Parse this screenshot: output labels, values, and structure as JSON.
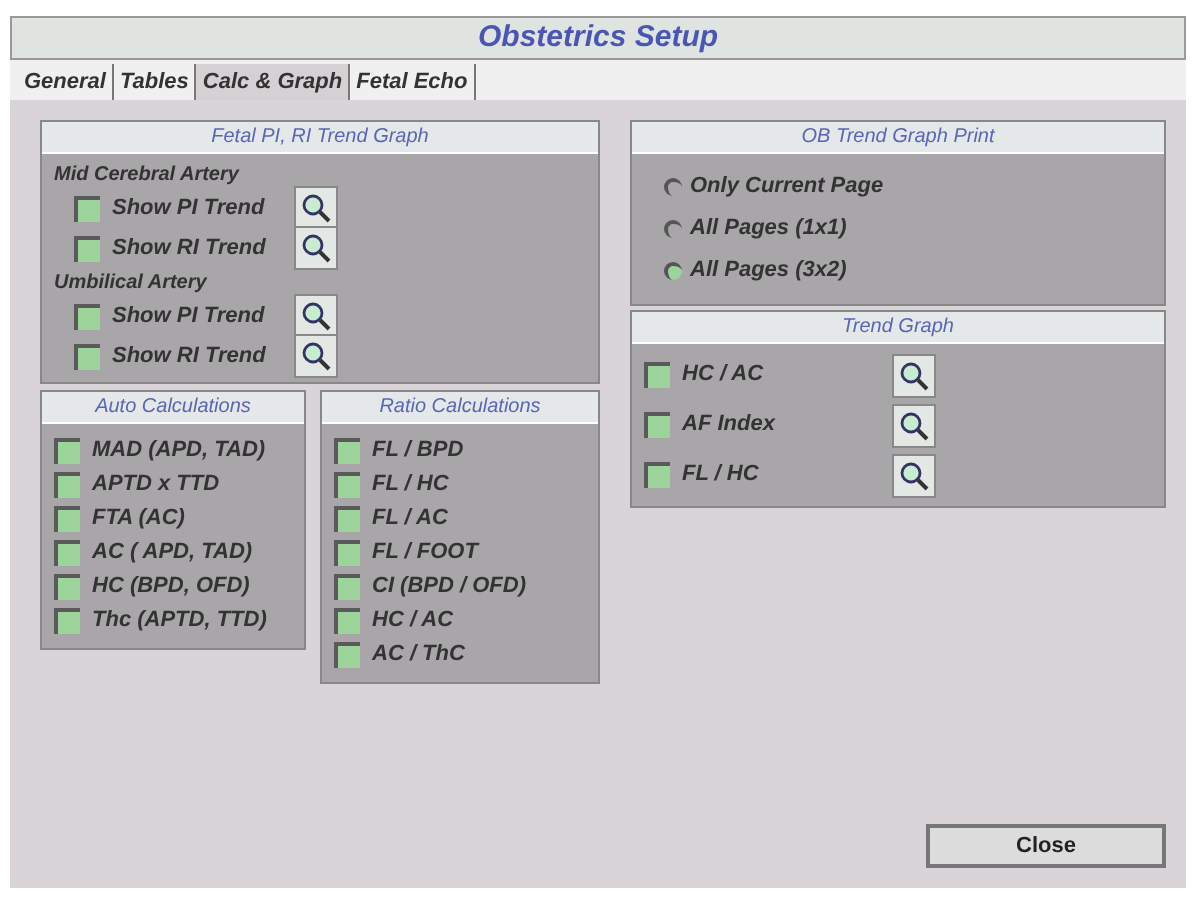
{
  "window": {
    "title": "Obstetrics Setup"
  },
  "tabs": [
    {
      "label": "General",
      "selected": false
    },
    {
      "label": "Tables",
      "selected": false
    },
    {
      "label": "Calc & Graph",
      "selected": true
    },
    {
      "label": "Fetal Echo",
      "selected": false
    }
  ],
  "fetal_trend": {
    "title": "Fetal PI, RI Trend Graph",
    "groups": [
      {
        "label": "Mid Cerebral Artery",
        "items": [
          {
            "label": "Show PI Trend",
            "checked": false
          },
          {
            "label": "Show RI Trend",
            "checked": false
          }
        ]
      },
      {
        "label": "Umbilical Artery",
        "items": [
          {
            "label": "Show PI Trend",
            "checked": false
          },
          {
            "label": "Show RI Trend",
            "checked": false
          }
        ]
      }
    ]
  },
  "auto_calculations": {
    "title": "Auto Calculations",
    "items": [
      {
        "label": "MAD (APD, TAD)",
        "checked": false
      },
      {
        "label": "APTD x TTD",
        "checked": false
      },
      {
        "label": "FTA (AC)",
        "checked": false
      },
      {
        "label": "AC ( APD, TAD)",
        "checked": false
      },
      {
        "label": "HC (BPD, OFD)",
        "checked": false
      },
      {
        "label": "Thc (APTD, TTD)",
        "checked": false
      }
    ]
  },
  "ratio_calculations": {
    "title": "Ratio Calculations",
    "items": [
      {
        "label": "FL / BPD",
        "checked": false
      },
      {
        "label": "FL / HC",
        "checked": false
      },
      {
        "label": "FL / AC",
        "checked": false
      },
      {
        "label": "FL / FOOT",
        "checked": false
      },
      {
        "label": "CI (BPD / OFD)",
        "checked": false
      },
      {
        "label": "HC / AC",
        "checked": false
      },
      {
        "label": "AC / ThC",
        "checked": false
      }
    ]
  },
  "ob_trend_print": {
    "title": "OB Trend Graph Print",
    "options": [
      {
        "label": "Only Current Page",
        "selected": false
      },
      {
        "label": "All Pages (1x1)",
        "selected": false
      },
      {
        "label": "All Pages (3x2)",
        "selected": true
      }
    ]
  },
  "trend_graph": {
    "title": "Trend Graph",
    "items": [
      {
        "label": "HC / AC",
        "checked": false
      },
      {
        "label": "AF Index",
        "checked": false
      },
      {
        "label": "FL / HC",
        "checked": false
      }
    ]
  },
  "buttons": [
    {
      "label": "Close"
    }
  ]
}
